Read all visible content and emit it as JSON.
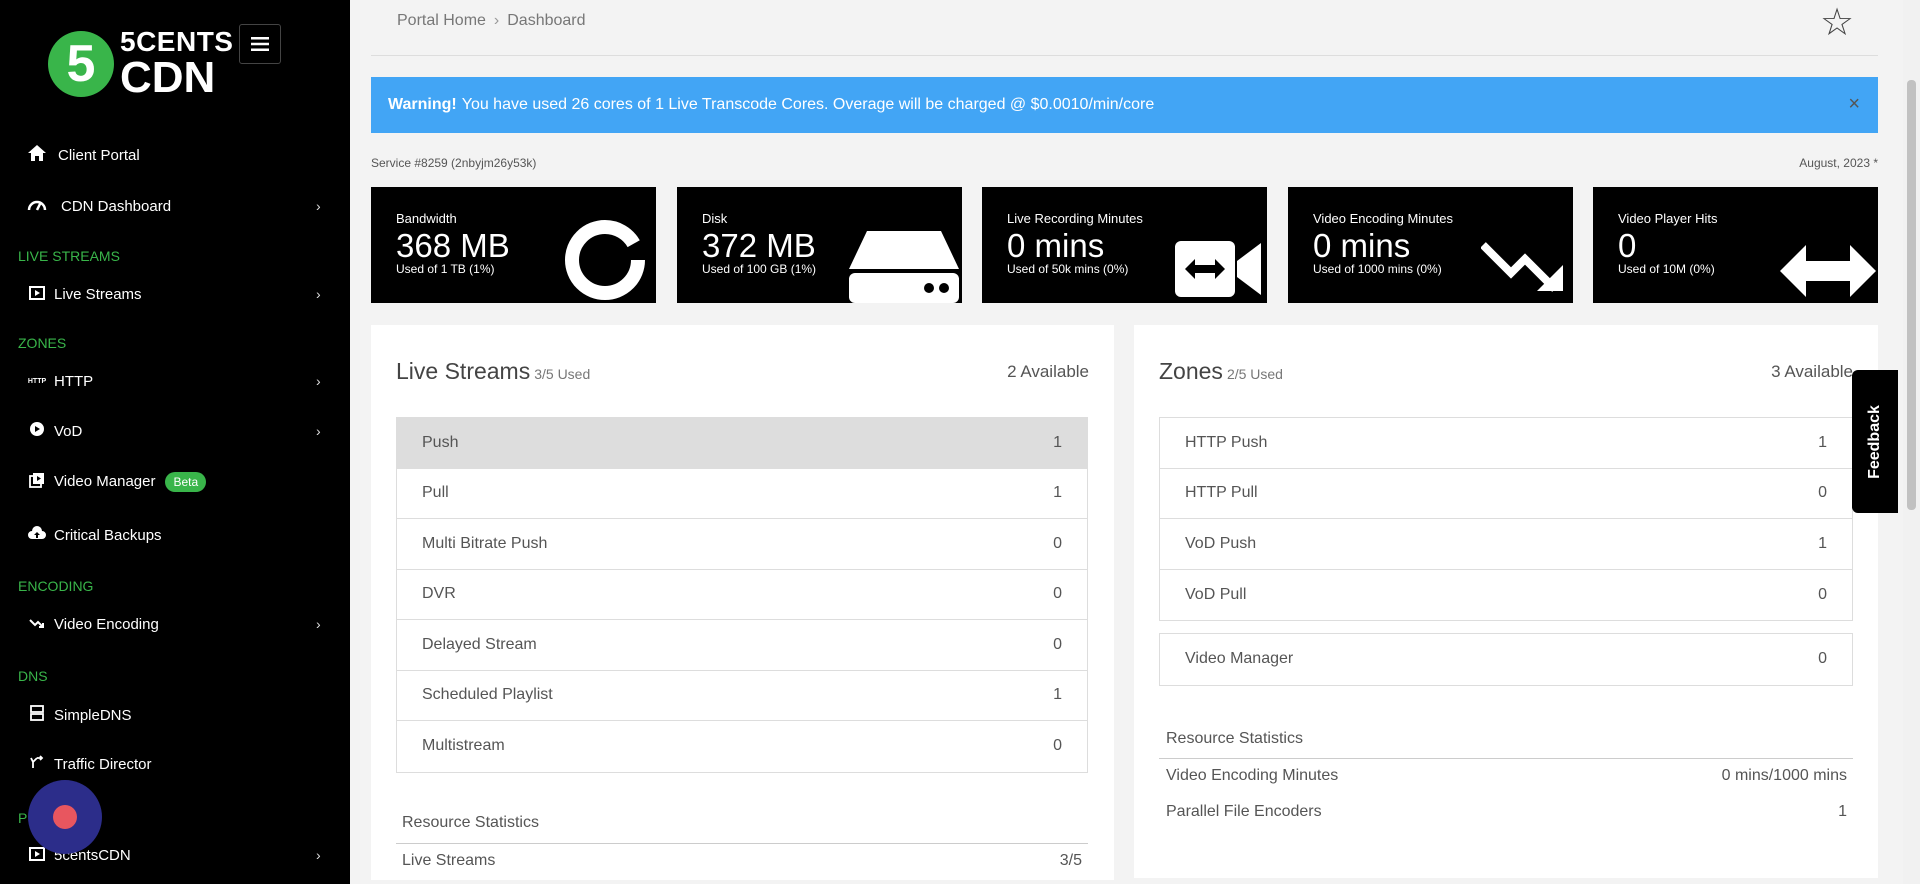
{
  "logo": {
    "digit": "5",
    "line1": "5CENTS",
    "line2": "CDN"
  },
  "sidebar": {
    "items": [
      {
        "label": "Client Portal",
        "icon": "home-icon"
      },
      {
        "label": "CDN Dashboard",
        "icon": "gauge-icon"
      },
      {
        "section": "LIVE STREAMS"
      },
      {
        "label": "Live Streams",
        "icon": "play-square-icon"
      },
      {
        "section": "ZONES"
      },
      {
        "label": "HTTP",
        "icon": "http-icon"
      },
      {
        "label": "VoD",
        "icon": "play-circle-icon"
      },
      {
        "label": "Video Manager",
        "icon": "video-library-icon",
        "badge": "Beta"
      },
      {
        "label": "Critical Backups",
        "icon": "cloud-upload-icon"
      },
      {
        "section": "ENCODING"
      },
      {
        "label": "Video Encoding",
        "icon": "trend-down-icon"
      },
      {
        "section": "DNS"
      },
      {
        "label": "SimpleDNS",
        "icon": "server-icon"
      },
      {
        "label": "Traffic Director",
        "icon": "fork-icon"
      },
      {
        "section": "P"
      },
      {
        "label": "5centsCDN",
        "icon": "play-square-icon"
      }
    ]
  },
  "breadcrumb": {
    "home": "Portal Home",
    "current": "Dashboard"
  },
  "alert": {
    "strong": "Warning!",
    "text": "You have used 26 cores of 1 Live Transcode Cores. Overage will be charged @ $0.0010/min/core",
    "close": "×"
  },
  "service": {
    "id": "Service #8259 (2nbyjm26y53k)",
    "period": "August, 2023 *"
  },
  "cards": [
    {
      "title": "Bandwidth",
      "value": "368 MB",
      "sub": "Used of 1 TB (1%)",
      "icon": "donut-chart-icon"
    },
    {
      "title": "Disk",
      "value": "372 MB",
      "sub": "Used of 100 GB (1%)",
      "icon": "hard-drive-icon"
    },
    {
      "title": "Live Recording Minutes",
      "value": "0 mins",
      "sub": "Used of 50k mins (0%)",
      "icon": "video-camera-icon"
    },
    {
      "title": "Video Encoding Minutes",
      "value": "0 mins",
      "sub": "Used of 1000 mins (0%)",
      "icon": "trend-down-icon"
    },
    {
      "title": "Video Player Hits",
      "value": "0",
      "sub": "Used of 10M (0%)",
      "icon": "arrows-horizontal-icon"
    }
  ],
  "live_streams": {
    "title": "Live Streams",
    "used": "3/5 Used",
    "available": "2 Available",
    "rows": [
      {
        "label": "Push",
        "value": "1"
      },
      {
        "label": "Pull",
        "value": "1"
      },
      {
        "label": "Multi Bitrate Push",
        "value": "0"
      },
      {
        "label": "DVR",
        "value": "0"
      },
      {
        "label": "Delayed Stream",
        "value": "0"
      },
      {
        "label": "Scheduled Playlist",
        "value": "1"
      },
      {
        "label": "Multistream",
        "value": "0"
      }
    ],
    "rs_title": "Resource Statistics",
    "rs_rows": [
      {
        "label": "Live Streams",
        "value": "3/5"
      }
    ]
  },
  "zones": {
    "title": "Zones",
    "used": "2/5 Used",
    "available": "3 Available",
    "rows": [
      {
        "label": "HTTP Push",
        "value": "1"
      },
      {
        "label": "HTTP Pull",
        "value": "0"
      },
      {
        "label": "VoD Push",
        "value": "1"
      },
      {
        "label": "VoD Pull",
        "value": "0"
      }
    ],
    "extra": {
      "label": "Video Manager",
      "value": "0"
    },
    "rs_title": "Resource Statistics",
    "rs_rows": [
      {
        "label": "Video Encoding Minutes",
        "value": "0 mins/1000 mins"
      },
      {
        "label": "Parallel File Encoders",
        "value": "1"
      }
    ]
  },
  "feedback": "Feedback"
}
